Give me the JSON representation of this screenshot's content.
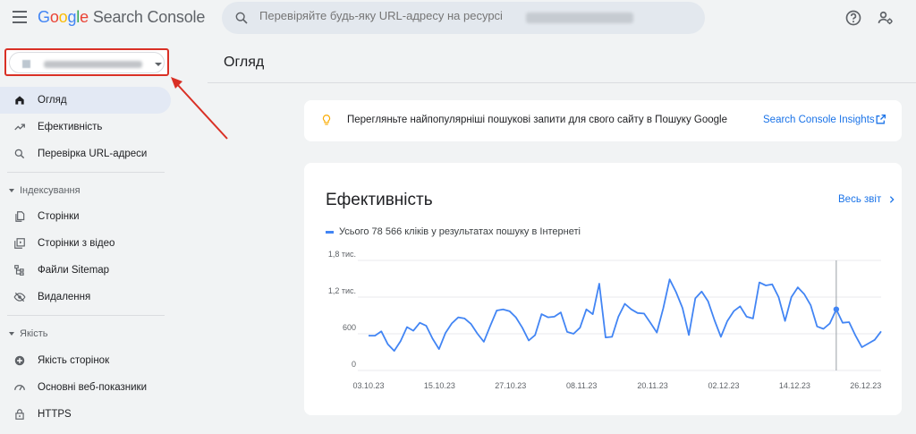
{
  "app": {
    "logo_word": [
      "G",
      "o",
      "o",
      "g",
      "l",
      "e"
    ],
    "product": "Search Console"
  },
  "search": {
    "placeholder": "Перевіряйте будь-яку URL-адресу на ресурсі"
  },
  "header_icons": [
    "help-icon",
    "manage-users-icon"
  ],
  "property": {
    "dropdown_icon": "arrow-drop-down-icon"
  },
  "sidebar": {
    "items": [
      {
        "label": "Огляд",
        "icon": "home-icon",
        "active": true
      },
      {
        "label": "Ефективність",
        "icon": "trending-up-icon"
      },
      {
        "label": "Перевірка URL-адреси",
        "icon": "search-icon"
      }
    ],
    "sections": [
      {
        "title": "Індексування",
        "items": [
          {
            "label": "Сторінки",
            "icon": "pages-icon"
          },
          {
            "label": "Сторінки з відео",
            "icon": "video-pages-icon"
          },
          {
            "label": "Файли Sitemap",
            "icon": "sitemap-icon"
          },
          {
            "label": "Видалення",
            "icon": "removals-icon"
          }
        ]
      },
      {
        "title": "Якість",
        "items": [
          {
            "label": "Якість сторінок",
            "icon": "page-experience-icon"
          },
          {
            "label": "Основні веб-показники",
            "icon": "speed-gauge-icon"
          },
          {
            "label": "HTTPS",
            "icon": "lock-icon"
          }
        ]
      }
    ]
  },
  "main": {
    "title": "Огляд",
    "insights": {
      "text": "Перегляньте найпопулярніші пошукові запити для свого сайту в Пошуку Google",
      "link": "Search Console Insights",
      "icon": "lightbulb-icon",
      "link_icon": "open-in-new-icon"
    },
    "performance": {
      "title": "Ефективність",
      "report_link": "Весь звіт",
      "legend": "Усього 78 566 кліків у результатах пошуку в Інтернеті"
    }
  },
  "colors": {
    "accent": "#1a73e8",
    "series": "#4285f4",
    "highlight": "#d93025"
  },
  "chart_data": {
    "type": "line",
    "series": [
      {
        "values": [
          570,
          570,
          640,
          430,
          320,
          480,
          710,
          650,
          780,
          730,
          520,
          350,
          610,
          770,
          870,
          850,
          760,
          600,
          470,
          730,
          980,
          1000,
          970,
          870,
          700,
          490,
          580,
          920,
          870,
          880,
          950,
          630,
          600,
          700,
          1000,
          920,
          1420,
          540,
          550,
          880,
          1090,
          1000,
          940,
          930,
          780,
          620,
          1020,
          1490,
          1280,
          1020,
          580,
          1180,
          1290,
          1130,
          820,
          550,
          810,
          970,
          1050,
          880,
          850,
          1440,
          1390,
          1410,
          1200,
          810,
          1200,
          1360,
          1250,
          1070,
          720,
          680,
          770,
          1000,
          780,
          790,
          570,
          380,
          440,
          500,
          640
        ]
      }
    ],
    "x_ticks": [
      "03.10.23",
      "15.10.23",
      "27.10.23",
      "08.11.23",
      "20.11.23",
      "02.12.23",
      "14.12.23",
      "26.12.23"
    ],
    "y_ticks": [
      "0",
      "600",
      "1,2 тис.",
      "1,8 тис."
    ],
    "ylim": [
      0,
      1800
    ],
    "grid": true,
    "highlight_index": 73
  }
}
